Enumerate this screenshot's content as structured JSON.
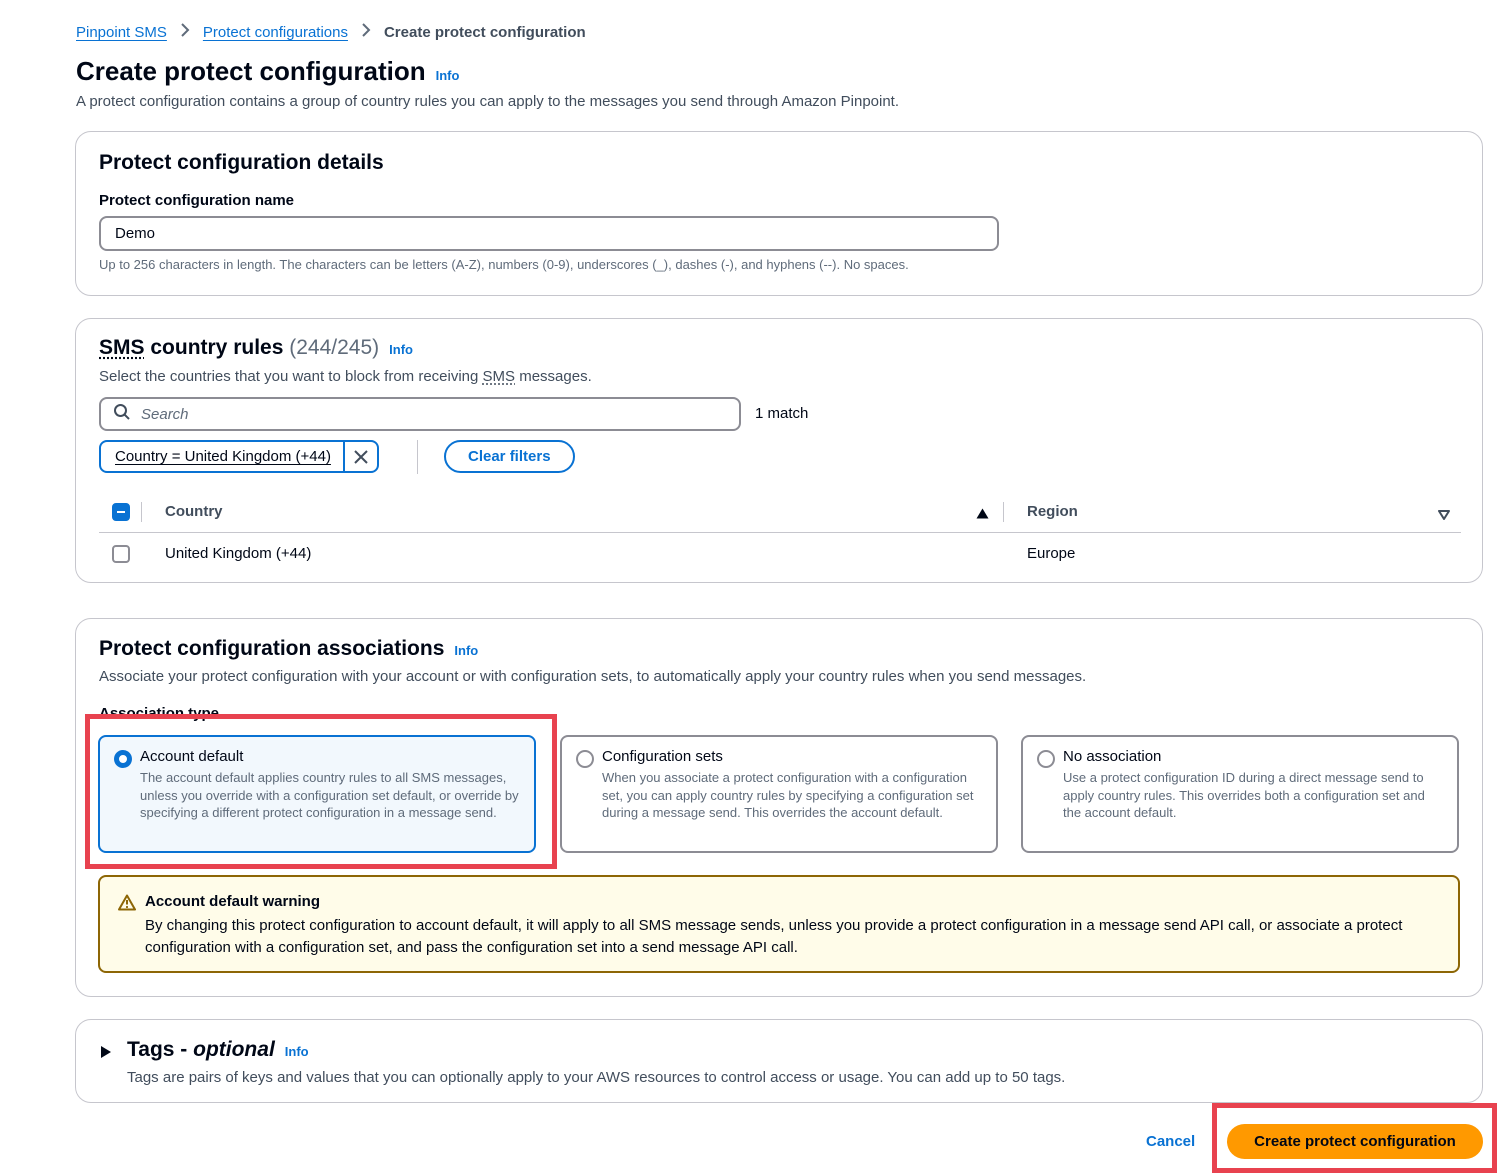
{
  "breadcrumb": {
    "items": [
      "Pinpoint SMS",
      "Protect configurations"
    ],
    "current": "Create protect configuration"
  },
  "page": {
    "title": "Create protect configuration",
    "info": "Info",
    "description": "A protect configuration contains a group of country rules you can apply to the messages you send through Amazon Pinpoint."
  },
  "details": {
    "title": "Protect configuration details",
    "name_label": "Protect configuration name",
    "name_value": "Demo",
    "name_hint": "Up to 256 characters in length. The characters can be letters (A-Z), numbers (0-9), underscores (_), dashes (-), and hyphens (--). No spaces."
  },
  "country_rules": {
    "title_abbr": "SMS",
    "title_rest": "country rules",
    "count": "(244/245)",
    "info": "Info",
    "desc_before": "Select the countries that you want to block from receiving ",
    "desc_abbr": "SMS",
    "desc_after": " messages.",
    "search_placeholder": "Search",
    "match_count": "1 match",
    "filter_token": "Country = United Kingdom (+44)",
    "clear_filters": "Clear filters",
    "columns": [
      "Country",
      "Region"
    ],
    "rows": [
      {
        "country": "United Kingdom (+44)",
        "region": "Europe"
      }
    ]
  },
  "associations": {
    "title": "Protect configuration associations",
    "info": "Info",
    "description": "Associate your protect configuration with your account or with configuration sets, to automatically apply your country rules when you send messages.",
    "group_label": "Association type",
    "options": [
      {
        "title": "Account default",
        "description": "The account default applies country rules to all SMS messages, unless you override with a configuration set default, or override by specifying a different protect configuration in a message send."
      },
      {
        "title": "Configuration sets",
        "description": "When you associate a protect configuration with a configuration set, you can apply country rules by specifying a configuration set during a message send. This overrides the account default."
      },
      {
        "title": "No association",
        "description": "Use a protect configuration ID during a direct message send to apply country rules. This overrides both a configuration set and the account default."
      }
    ],
    "selected": "Account default",
    "warning_title": "Account default warning",
    "warning_body": "By changing this protect configuration to account default, it will apply to all SMS message sends, unless you provide a protect configuration in a message send API call, or associate a protect configuration with a configuration set, and pass the configuration set into a send message API call."
  },
  "tags": {
    "title": "Tags - ",
    "optional": "optional",
    "info": "Info",
    "description": "Tags are pairs of keys and values that you can optionally apply to your AWS resources to control access or usage. You can add up to 50 tags."
  },
  "footer": {
    "cancel": "Cancel",
    "submit": "Create protect configuration"
  },
  "colors": {
    "link": "#0972d3",
    "primary_button": "#ff9900",
    "highlight": "#e8424f",
    "warning_bg": "#fffce9",
    "warning_border": "#8d6605"
  },
  "icons": {
    "breadcrumb_separator": "chevron-right-icon",
    "search": "search-icon",
    "dismiss": "close-icon",
    "sort_asc": "caret-up-icon",
    "sort_other": "caret-down-outline-icon",
    "warning": "warning-icon",
    "expand": "caret-right-icon"
  }
}
